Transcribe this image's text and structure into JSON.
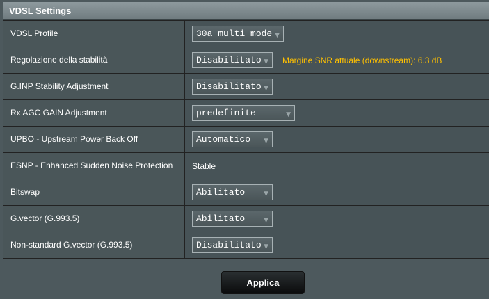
{
  "section": {
    "title": "VDSL Settings"
  },
  "rows": [
    {
      "label": "VDSL Profile",
      "value": "30a multi mode"
    },
    {
      "label": "Regolazione della stabilità",
      "value": "Disabilitato",
      "note": "Margine SNR attuale (downstream): 6.3 dB"
    },
    {
      "label": "G.INP Stability Adjustment",
      "value": "Disabilitato"
    },
    {
      "label": "Rx AGC GAIN Adjustment",
      "value": "predefinite"
    },
    {
      "label": "UPBO - Upstream Power Back Off",
      "value": "Automatico"
    },
    {
      "label": "ESNP - Enhanced Sudden Noise Protection",
      "value": "Stable"
    },
    {
      "label": "Bitswap",
      "value": "Abilitato"
    },
    {
      "label": "G.vector (G.993.5)",
      "value": "Abilitato"
    },
    {
      "label": "Non-standard G.vector (G.993.5)",
      "value": "Disabilitato"
    }
  ],
  "apply_label": "Applica",
  "colors": {
    "background": "#4d595d",
    "note": "#ffc000",
    "button": "#1a1d1f"
  }
}
